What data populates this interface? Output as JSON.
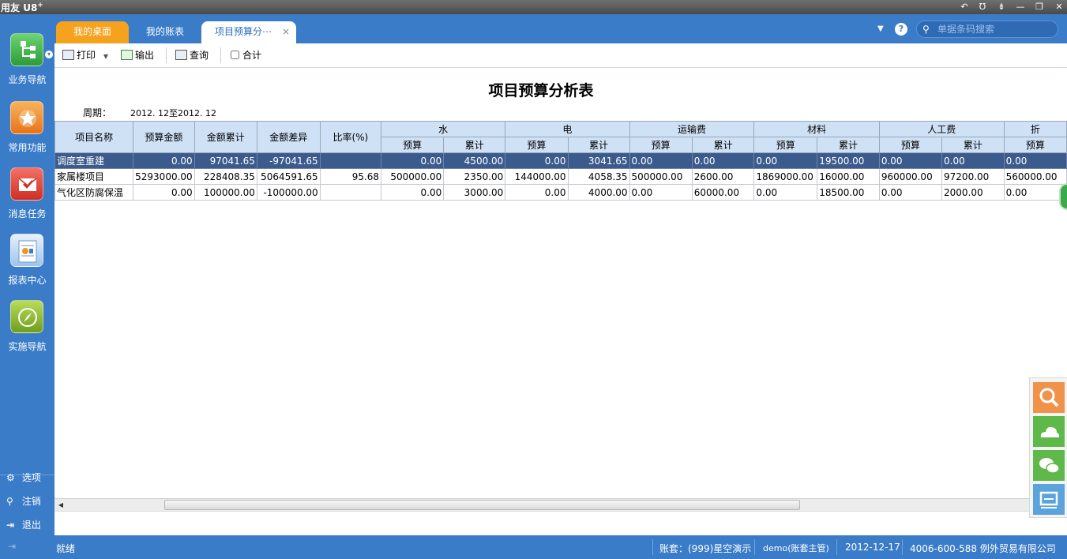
{
  "app": {
    "brand": "用友",
    "brand_suffix": "U8",
    "brand_plus": "+"
  },
  "window_controls": [
    "↶",
    "Ʊ",
    "⇟",
    "—",
    "❐",
    "✕"
  ],
  "sidebar": {
    "items": [
      {
        "label": "业务导航",
        "icon": "tree-nav-icon",
        "color": "#3fb34a"
      },
      {
        "label": "常用功能",
        "icon": "star-icon",
        "color": "#f39325"
      },
      {
        "label": "消息任务",
        "icon": "mail-check-icon",
        "color": "#e8473c"
      },
      {
        "label": "报表中心",
        "icon": "report-icon",
        "color": "#4a90d9"
      },
      {
        "label": "实施导航",
        "icon": "compass-icon",
        "color": "#8dbb2f"
      }
    ],
    "options": [
      {
        "label": "选项",
        "icon": "gear-icon"
      },
      {
        "label": "注销",
        "icon": "key-icon"
      },
      {
        "label": "退出",
        "icon": "exit-icon"
      }
    ]
  },
  "tabs": {
    "desk": "我的桌面",
    "ledger": "我的账表",
    "report": "项目预算分⋯",
    "close": "×"
  },
  "search": {
    "placeholder": "单据条码搜索"
  },
  "toolbar": {
    "print": "打印",
    "export": "输出",
    "query": "查询",
    "total": "合计"
  },
  "report": {
    "title": "项目预算分析表",
    "period_label": "周期：",
    "period_value": "2012. 12至2012. 12",
    "columns": {
      "name": "项目名称",
      "budget": "预算金额",
      "cumulative": "金额累计",
      "difference": "金额差异",
      "ratio": "比率(%)",
      "groups": [
        "水",
        "电",
        "运输费",
        "材料",
        "人工费",
        "折"
      ],
      "sub_budget": "预算",
      "sub_cumulative": "累计"
    },
    "rows": [
      {
        "name": "调度室重建",
        "budget": "0.00",
        "cumulative": "97041.65",
        "difference": "-97041.65",
        "ratio": "",
        "water_b": "0.00",
        "water_c": "4500.00",
        "elec_b": "0.00",
        "elec_c": "3041.65",
        "trans_b": "0.00",
        "trans_c": "0.00",
        "mat_b": "0.00",
        "mat_c": "19500.00",
        "labor_b": "0.00",
        "labor_c": "0.00",
        "dep_b": "0.00"
      },
      {
        "name": "家属楼项目",
        "budget": "5293000.00",
        "cumulative": "228408.35",
        "difference": "5064591.65",
        "ratio": "95.68",
        "water_b": "500000.00",
        "water_c": "2350.00",
        "elec_b": "144000.00",
        "elec_c": "4058.35",
        "trans_b": "500000.00",
        "trans_c": "2600.00",
        "mat_b": "1869000.00",
        "mat_c": "16000.00",
        "labor_b": "960000.00",
        "labor_c": "97200.00",
        "dep_b": "560000.00"
      },
      {
        "name": "气化区防腐保温",
        "budget": "0.00",
        "cumulative": "100000.00",
        "difference": "-100000.00",
        "ratio": "",
        "water_b": "0.00",
        "water_c": "3000.00",
        "elec_b": "0.00",
        "elec_c": "4000.00",
        "trans_b": "0.00",
        "trans_c": "60000.00",
        "mat_b": "0.00",
        "mat_c": "18500.00",
        "labor_b": "0.00",
        "labor_c": "2000.00",
        "dep_b": "0.00"
      }
    ]
  },
  "status": {
    "ready": "就绪",
    "account": "账套：(999)星空演示",
    "user": "demo(账套主管)",
    "date": "2012-12-17",
    "phone_company": "4006-600-588 例外贸易有限公司"
  },
  "float_panel": [
    {
      "icon": "search-icon",
      "color": "#f0924a"
    },
    {
      "icon": "cloud-icon",
      "color": "#5fb84a"
    },
    {
      "icon": "chat-icon",
      "color": "#5fb84a"
    },
    {
      "icon": "feedback-icon",
      "color": "#5aa3dc"
    }
  ]
}
